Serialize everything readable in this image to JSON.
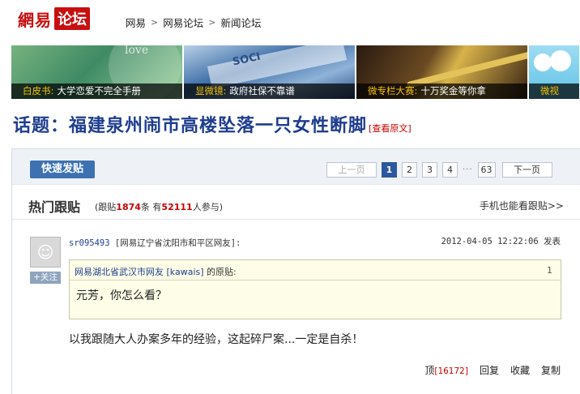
{
  "header": {
    "logo_brand": "網易",
    "logo_forum": "论坛",
    "breadcrumbs": [
      "网易",
      "网易论坛",
      "新闻论坛"
    ],
    "separator": ">"
  },
  "banners": [
    {
      "tag": "白皮书:",
      "text": "大学恋爱不完全手册",
      "overlay_word": "love"
    },
    {
      "tag": "显微镜:",
      "text": "政府社保不靠谱",
      "overlay_word": "SOCI"
    },
    {
      "tag": "微专栏大赛:",
      "text": "十万奖金等你拿"
    },
    {
      "tag": "微视",
      "text": ""
    }
  ],
  "topic": {
    "label": "话题：",
    "title": "福建泉州闹市高楼坠落一只女性断脚",
    "view_original": "[查看原文]"
  },
  "toolbar": {
    "post_button": "快速发贴",
    "prev_label": "上一页",
    "pages": [
      "1",
      "2",
      "3",
      "4"
    ],
    "current_page": "1",
    "ellipsis": "···",
    "last_page": "63",
    "next_label": "下一页"
  },
  "hot": {
    "title": "热门跟贴",
    "stats_prefix": "(跟贴",
    "reply_count": "1874",
    "stats_mid": "条 有",
    "participant_count": "52111",
    "stats_suffix": "人参与)",
    "mobile_link": "手机也能看跟贴>>"
  },
  "post": {
    "username": "sr095493",
    "location": "[网易辽宁省沈阳市和平区网友]:",
    "time": "2012-04-05 12:22:06 发表",
    "follow": "+关注",
    "quote_user": "网易湖北省武汉市网友 [kawais]",
    "quote_suffix": " 的原贴:",
    "quote_index": "1",
    "quote_text": "元芳，你怎么看？",
    "reply_text": "以我跟随大人办案多年的经验，这起碎尸案...一定是自杀！",
    "actions": {
      "up_label": "顶",
      "up_count": "[16172]",
      "reply": "回复",
      "favorite": "收藏",
      "copy": "复制"
    }
  },
  "colors": {
    "brand_red": "#c80f0f",
    "title_blue": "#1e3d8f",
    "button_blue": "#3d71b1",
    "highlight_red": "#cc0000"
  }
}
